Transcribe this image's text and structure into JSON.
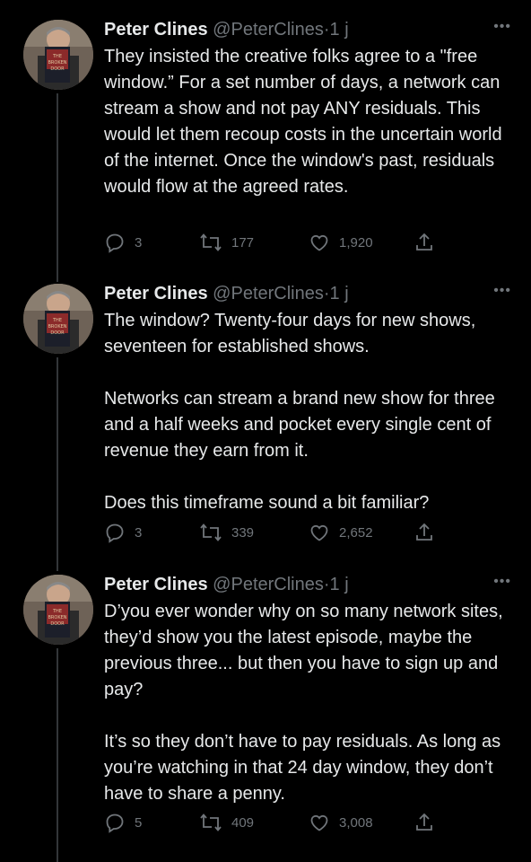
{
  "author": {
    "name": "Peter Clines",
    "handle": "@PeterClines",
    "separator": "·",
    "time": "1 j",
    "avatar_book_text": "THE BROKEN DOOR"
  },
  "more_icon": "more-horizontal-icon",
  "tweets": [
    {
      "paragraphs": [
        "They insisted the creative folks agree to a \"free window.” For a set number of days, a network can stream a show and not pay ANY residuals. This would let them recoup costs in the uncertain world of the internet. Once the window's past, residuals would flow at the agreed rates."
      ],
      "replies": "3",
      "retweets": "177",
      "likes": "1,920"
    },
    {
      "paragraphs": [
        "The window? Twenty-four days for new shows, seventeen for established shows.",
        "Networks can stream a brand new show for three and a half weeks and pocket every single cent of revenue they earn from it.",
        "Does this timeframe sound a bit familiar?"
      ],
      "replies": "3",
      "retweets": "339",
      "likes": "2,652"
    },
    {
      "paragraphs": [
        "D’you ever wonder why on so many network sites, they’d show you the latest episode, maybe the previous three... but then you have to sign up and pay?",
        "It’s so they don’t have to pay residuals. As long as you’re watching in that 24 day window, they don’t have to share a penny."
      ],
      "replies": "5",
      "retweets": "409",
      "likes": "3,008"
    }
  ],
  "colors": {
    "background": "#000000",
    "text": "#e7e9ea",
    "muted": "#71767b",
    "thread_line": "#333639"
  }
}
